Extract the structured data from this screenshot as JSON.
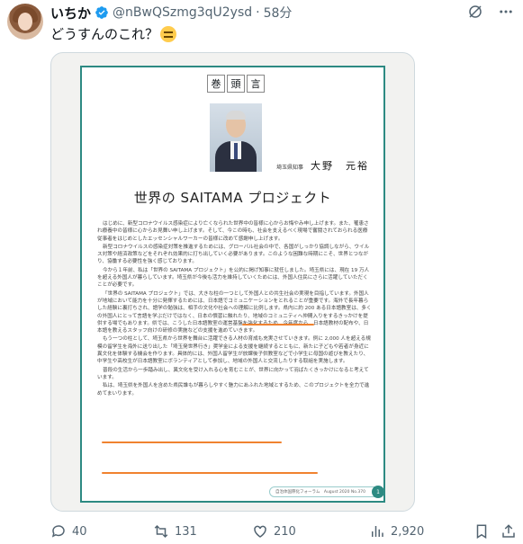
{
  "tweet": {
    "display_name": "いちか",
    "handle": "@nBwQSzmg3qU2ysd",
    "separator": "·",
    "time": "58分",
    "text": "どうすんのこれ？",
    "emoji_icon": "expressionless-face-emoji"
  },
  "document": {
    "heading_chars": [
      "巻",
      "頭",
      "言"
    ],
    "author_title": "埼玉県知事",
    "author_name": "大野　元裕",
    "title": "世界の SAITAMA プロジェクト",
    "paragraphs": [
      "はじめに、新型コロナウイルス感染症により亡くなられた世界中の皆様に心からお悔やみ申し上げます。また、罹患され療養中の皆様に心からお見舞い申し上げます。そして、今この時も、社会を支えるべく現場で奮闘されておられる医療従事者をはじめとしたエッセンシャルワーカーの皆様に改めて感謝申し上げます。",
      "新型コロナウイルスの感染症対策を推進するためには、グローバル社会の中で、各国がしっかり協調しながら、ウイルス対策や経済政策などをそれぞれ効果的に打ち出していく必要があります。このような困難な時期にこそ、世界とつながり、協働する必要性を強く感じております。",
      "今から１年前、私は「世界の SAITAMA プロジェクト」を公約に掲げ知事に就任しました。埼玉県には、現在 19 万人を超える外国人が暮らしています。埼玉県が今後も活力を維持していくためには、外国人住民にさらに活躍していただくことが必要です。",
      "「世界の SAITAMA プロジェクト」では、大きな柱の一つとして外国人との共生社会の実現を目指しています。外国人が地域において能力を十分に発揮するためには、日本語でコミュニケーションをとれることが重要です。海外で長年暮らした経験に裏打ちされ、語学の勉強は、相手の文化や社会への理解に比例します。県内に約 200 ある日本語教室は、多くの外国人にとって言語を学ぶだけではなく、日本の慣習に触れたり、地域のコミュニティへ仲間入りをするきっかけを提供する場でもあります。県では、こうした日本語教室の運営基盤を強化するため、今年度から、日本語教材の配布や、日本語を教えるスタッフ向けの研修の実施などの支援を進めていきます。",
      "もう一つの柱として、埼玉県から世界を舞台に活躍できる人材の育成も充実させていきます。例に 2,000 人を超える規模の留学生を海外に送り出した「埼玉発世界行き」奨学金による支援を継続するとともに、新たに子どもや若者が身近に異文化を体験する機会を作ります。具体的には、外国人留学生が放課後子供教室などで小学生に母国の遊びを教えたり、中学生や高校生が日本語教室にボランティアとして参加し、地域の外国人と交流したりする取組を実施します。",
      "普段の生活から一歩踏み出し、異文化を受け入れる心を育むことが、世界に向かって羽ばたくきっかけになると考えています。",
      "私は、埼玉県を外国人を含めた県民誰もが暮らしやすく魅力にあふれた地域とするため、このプロジェクトを全力で進めてまいります。"
    ],
    "footer_text": "自治体国際化フォーラム　August 2020 No.370",
    "page_number": "1"
  },
  "actions": {
    "replies": "40",
    "retweets": "131",
    "likes": "210",
    "views": "2,920"
  },
  "colors": {
    "accent": "#1d9bf0",
    "page_border": "#2d8a82",
    "highlight": "#f0822f"
  }
}
